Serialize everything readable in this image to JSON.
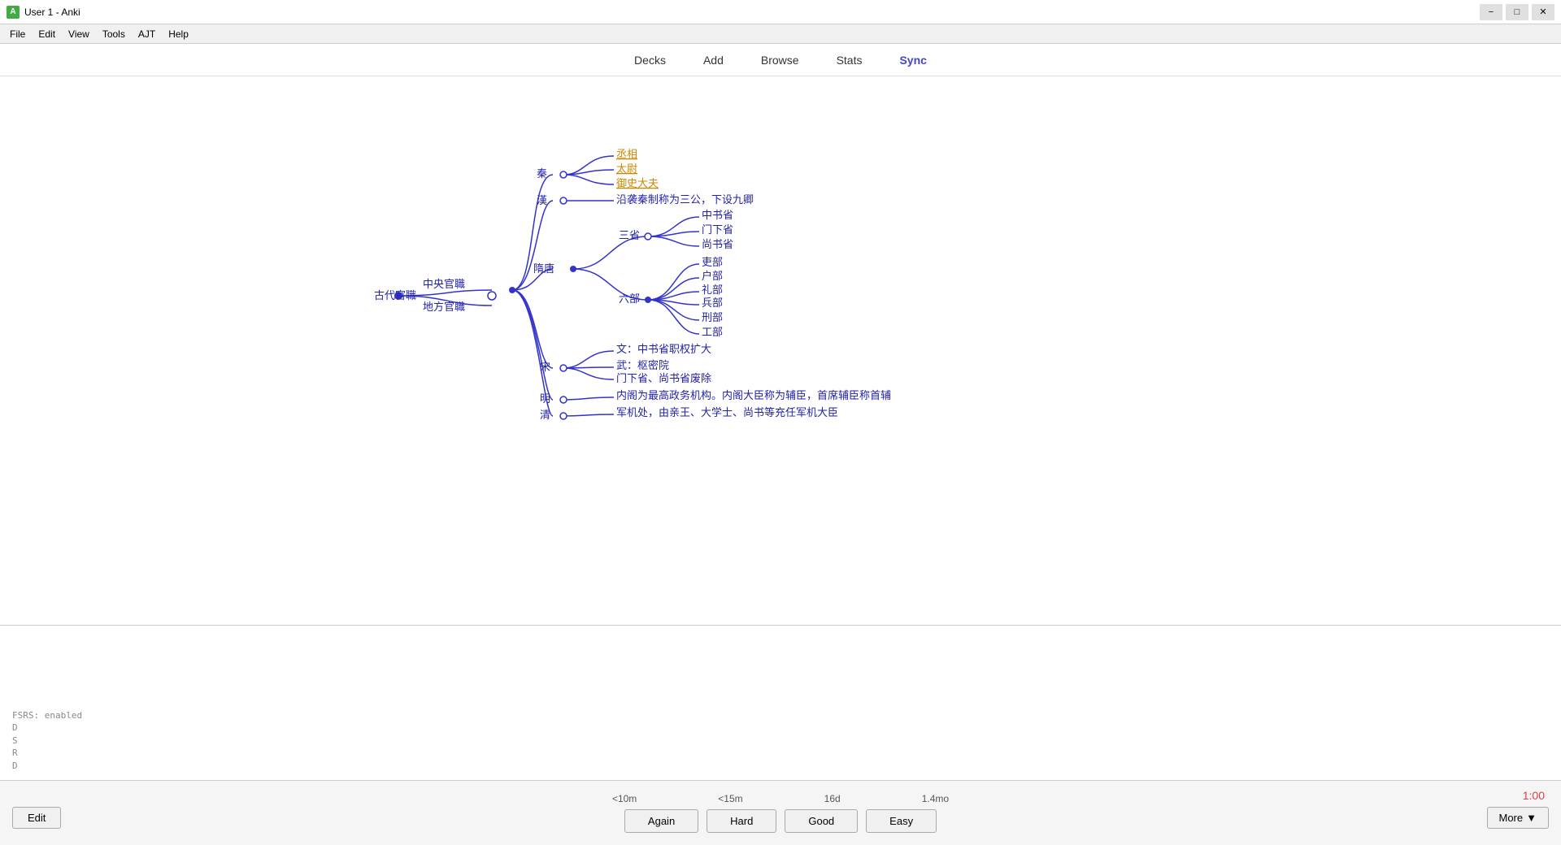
{
  "window": {
    "title": "User 1 - Anki"
  },
  "titlebar": {
    "min": "−",
    "max": "□",
    "close": "✕"
  },
  "menubar": {
    "items": [
      "File",
      "Edit",
      "View",
      "Tools",
      "AJT",
      "Help"
    ]
  },
  "nav": {
    "tabs": [
      "Decks",
      "Add",
      "Browse",
      "Stats",
      "Sync"
    ],
    "active": "Sync"
  },
  "status": {
    "line1": "FSRS: enabled",
    "line2": "D",
    "line3": "S",
    "line4": "R",
    "line5": "D"
  },
  "bottom": {
    "timer": "1:00",
    "edit_label": "Edit",
    "more_label": "More",
    "more_arrow": "▼",
    "times": [
      {
        "label": "<10m"
      },
      {
        "label": "<15m"
      },
      {
        "label": "16d"
      },
      {
        "label": "1.4mo"
      }
    ],
    "buttons": [
      {
        "label": "Again"
      },
      {
        "label": "Hard"
      },
      {
        "label": "Good"
      },
      {
        "label": "Easy"
      }
    ]
  },
  "mindmap": {
    "root": "古代官職",
    "branches": [
      {
        "label": "中央官職",
        "children": [
          {
            "label": "秦",
            "children": [
              {
                "label": "丞相",
                "highlight": true
              },
              {
                "label": "太尉",
                "highlight": true
              },
              {
                "label": "御史大夫",
                "highlight": true
              }
            ]
          },
          {
            "label": "漢",
            "children": [
              {
                "label": "沿袭秦制称为三公，下设九卿"
              }
            ]
          },
          {
            "label": "隋唐",
            "children": [
              {
                "label": "三省",
                "children": [
                  {
                    "label": "中书省"
                  },
                  {
                    "label": "门下省"
                  },
                  {
                    "label": "尚书省"
                  }
                ]
              },
              {
                "label": "六部",
                "children": [
                  {
                    "label": "吏部"
                  },
                  {
                    "label": "户部"
                  },
                  {
                    "label": "礼部"
                  },
                  {
                    "label": "兵部"
                  },
                  {
                    "label": "刑部"
                  },
                  {
                    "label": "工部"
                  }
                ]
              }
            ]
          },
          {
            "label": "宋",
            "children": [
              {
                "label": "文：中书省职权扩大"
              },
              {
                "label": "武：枢密院"
              },
              {
                "label": "门下省、尚书省废除"
              }
            ]
          },
          {
            "label": "明",
            "children": [
              {
                "label": "内阁为最高政务机构。内阁大臣称为辅臣，首席辅臣称首辅"
              }
            ]
          },
          {
            "label": "清",
            "children": [
              {
                "label": "军机处，由亲王、大学士、尚书等充任军机大臣"
              }
            ]
          }
        ]
      },
      {
        "label": "地方官職",
        "children": []
      }
    ]
  }
}
